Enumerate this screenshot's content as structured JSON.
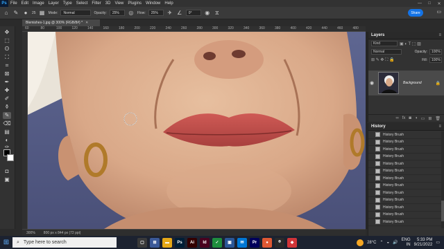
{
  "app": {
    "logo": "Ps"
  },
  "menu": [
    "File",
    "Edit",
    "Image",
    "Layer",
    "Type",
    "Select",
    "Filter",
    "3D",
    "View",
    "Plugins",
    "Window",
    "Help"
  ],
  "window_controls": [
    "—",
    "□",
    "✕"
  ],
  "options": {
    "brush_size": "25",
    "mode_label": "Mode:",
    "mode_value": "Normal",
    "opacity_label": "Opacity:",
    "opacity_value": "25%",
    "flow_label": "Flow:",
    "flow_value": "25%",
    "angle_value": "0°",
    "share_label": "Share"
  },
  "document": {
    "tab_title": "Blemishes-1.jpg @ 300% (RGB/8#) *",
    "zoom": "300%",
    "dimensions": "800 px x 844 px (72 ppi)"
  },
  "ruler_ticks": [
    "60",
    "80",
    "100",
    "120",
    "140",
    "160",
    "180",
    "200",
    "220",
    "240",
    "260",
    "280",
    "300",
    "320",
    "340",
    "360",
    "380",
    "400",
    "420",
    "440",
    "460",
    "480"
  ],
  "layers": {
    "title": "Layers",
    "filter_placeholder": "Kind",
    "blend_mode": "Normal",
    "opacity_label": "Opacity:",
    "opacity_value": "100%",
    "fill_label": "Fill:",
    "fill_value": "100%",
    "layer_name": "Background"
  },
  "history": {
    "title": "History",
    "items": [
      "History Brush",
      "History Brush",
      "History Brush",
      "History Brush",
      "History Brush",
      "History Brush",
      "History Brush",
      "History Brush",
      "History Brush",
      "History Brush",
      "History Brush",
      "History Brush",
      "History Brush"
    ]
  },
  "taskbar": {
    "search_placeholder": "Type here to search",
    "weather": "28°C",
    "lang_top": "ENG",
    "lang_bottom": "IN",
    "time": "5:33 PM",
    "date": "9/21/2022"
  },
  "task_icons": [
    {
      "label": "▢",
      "color": "#3a3a3a"
    },
    {
      "label": "⊞",
      "color": "#3b5998"
    },
    {
      "label": "▬",
      "color": "#e6a817"
    },
    {
      "label": "Ps",
      "color": "#001e36"
    },
    {
      "label": "Ai",
      "color": "#330000"
    },
    {
      "label": "Id",
      "color": "#49021f"
    },
    {
      "label": "✓",
      "color": "#1e8e3e"
    },
    {
      "label": "▣",
      "color": "#2b5797"
    },
    {
      "label": "✉",
      "color": "#0078d4"
    },
    {
      "label": "Pr",
      "color": "#00005b"
    },
    {
      "label": "●",
      "color": "#de5833"
    },
    {
      "label": "⌾",
      "color": "#2a2a2a"
    },
    {
      "label": "◆",
      "color": "#d13438"
    }
  ]
}
